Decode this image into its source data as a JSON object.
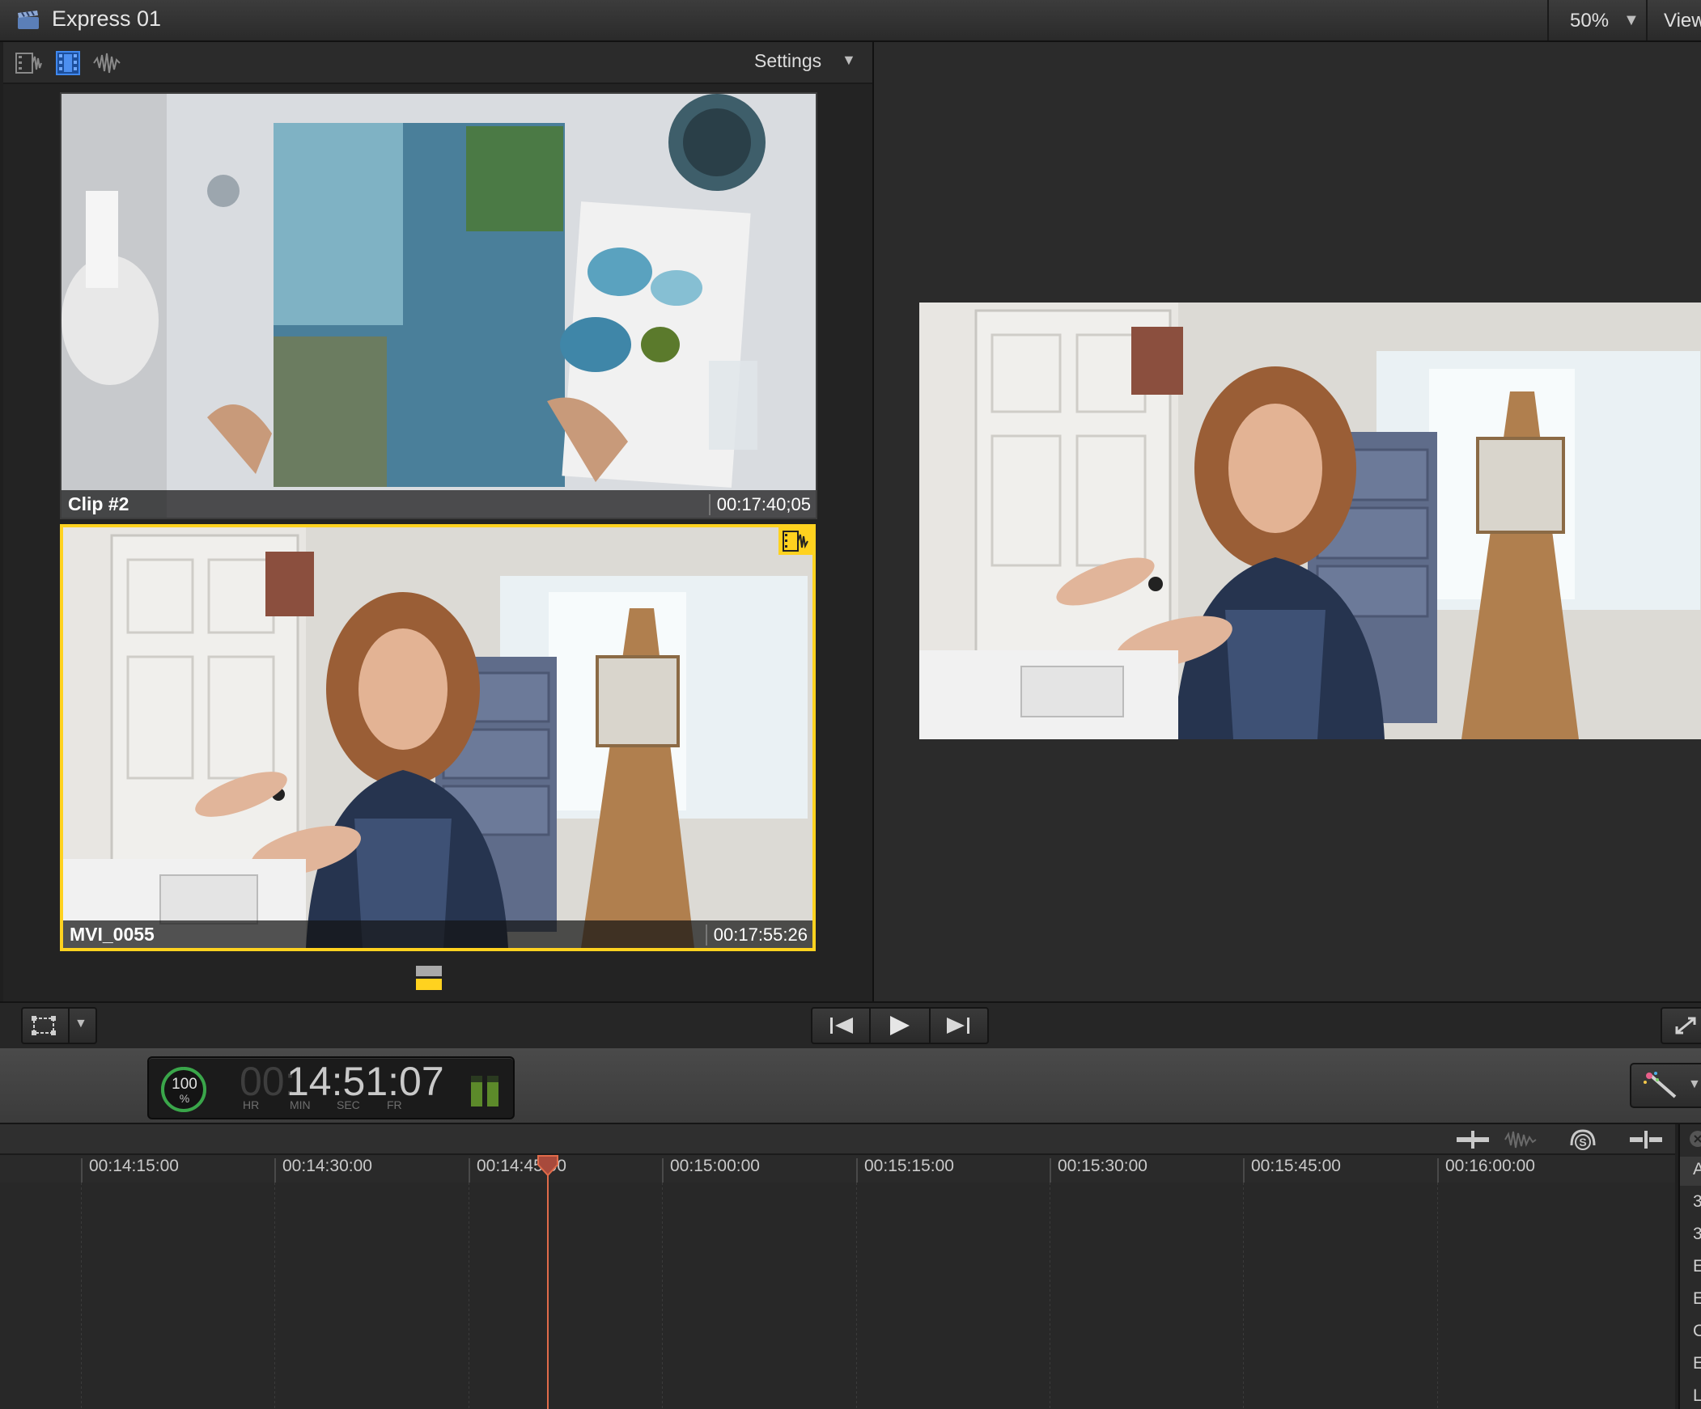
{
  "window": {
    "title": "Express 01",
    "zoom": "50%",
    "view_menu": "View"
  },
  "angle_viewer": {
    "toolbar_icons": [
      "video-audio-icon",
      "video-only-icon",
      "audio-only-icon"
    ],
    "settings_label": "Settings",
    "angles": [
      {
        "name": "Clip #2",
        "timecode": "00:17:40;05",
        "active": false
      },
      {
        "name": "MVI_0055",
        "timecode": "00:17:55:26",
        "active": true
      }
    ]
  },
  "dashboard": {
    "progress_value": "100",
    "progress_unit": "%",
    "timecode_hr": "00:",
    "timecode_main": "14:51:07",
    "labels": {
      "hr": "HR",
      "min": "MIN",
      "sec": "SEC",
      "fr": "FR"
    }
  },
  "timeline": {
    "ruler_ticks": [
      "00:14:15:00",
      "00:14:30:00",
      "00:14:45:00",
      "00:15:00:00",
      "00:15:15:00",
      "00:15:30:00",
      "00:15:45:00",
      "00:16:00:00"
    ],
    "side_items": [
      "A",
      "3",
      "3",
      "E",
      "E",
      "C",
      "E",
      "L"
    ]
  },
  "colors": {
    "active_angle": "#ffd21f",
    "playhead": "#e06b4a",
    "progress_ring": "#3aa64a"
  }
}
